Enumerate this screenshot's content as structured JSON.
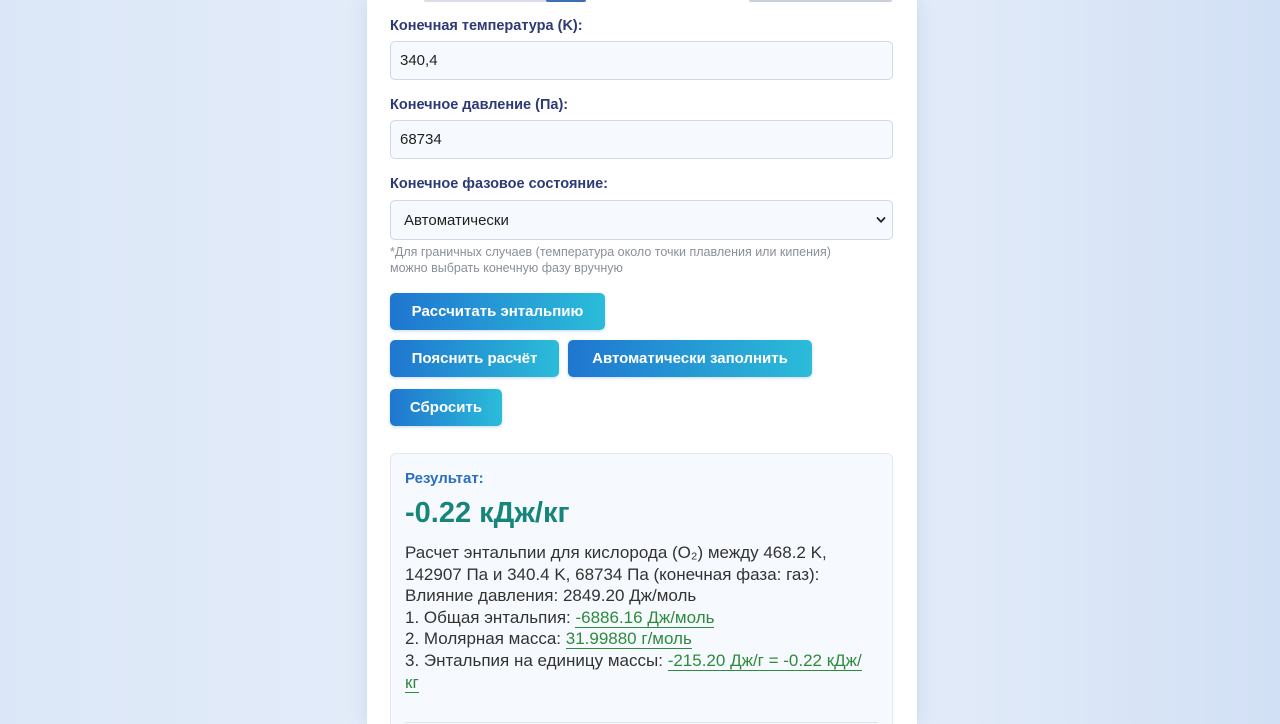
{
  "form": {
    "final_temp_label": "Конечная температура (K):",
    "final_temp_value": "340,4",
    "final_pressure_label": "Конечное давление (Па):",
    "final_pressure_value": "68734",
    "final_phase_label": "Конечное фазовое состояние:",
    "final_phase_selected": "Автоматически",
    "hint": "*Для граничных случаев (температура около точки плавления или кипения) можно выбрать конечную фазу вручную"
  },
  "buttons": {
    "calculate": "Рассчитать энтальпию",
    "explain": "Пояснить расчёт",
    "autofill": "Автоматически заполнить",
    "reset": "Сбросить"
  },
  "result": {
    "heading": "Результат:",
    "value": "-0.22 кДж/кг",
    "description": "Расчет энтальпии для кислорода (O₂) между 468.2 K, 142907 Па и 340.4 K, 68734 Па (конечная фаза: газ):",
    "pressure_effect": "Влияние давления: 2849.20 Дж/моль",
    "step1_label": "1. Общая энтальпия: ",
    "step1_value": "-6886.16 Дж/моль",
    "step2_label": "2. Молярная масса: ",
    "step2_value": "31.99880 г/моль",
    "step3_label": "3. Энтальпия на единицу массы: ",
    "step3_value": "-215.20 Дж/г = -0.22 кДж/кг"
  },
  "colors": {
    "label": "#2d3a73",
    "button_start": "#1f76d0",
    "button_end": "#2bbcd9",
    "result_heading": "#2a6fc0",
    "result_value": "#17857a",
    "highlight": "#2e8b3e"
  }
}
